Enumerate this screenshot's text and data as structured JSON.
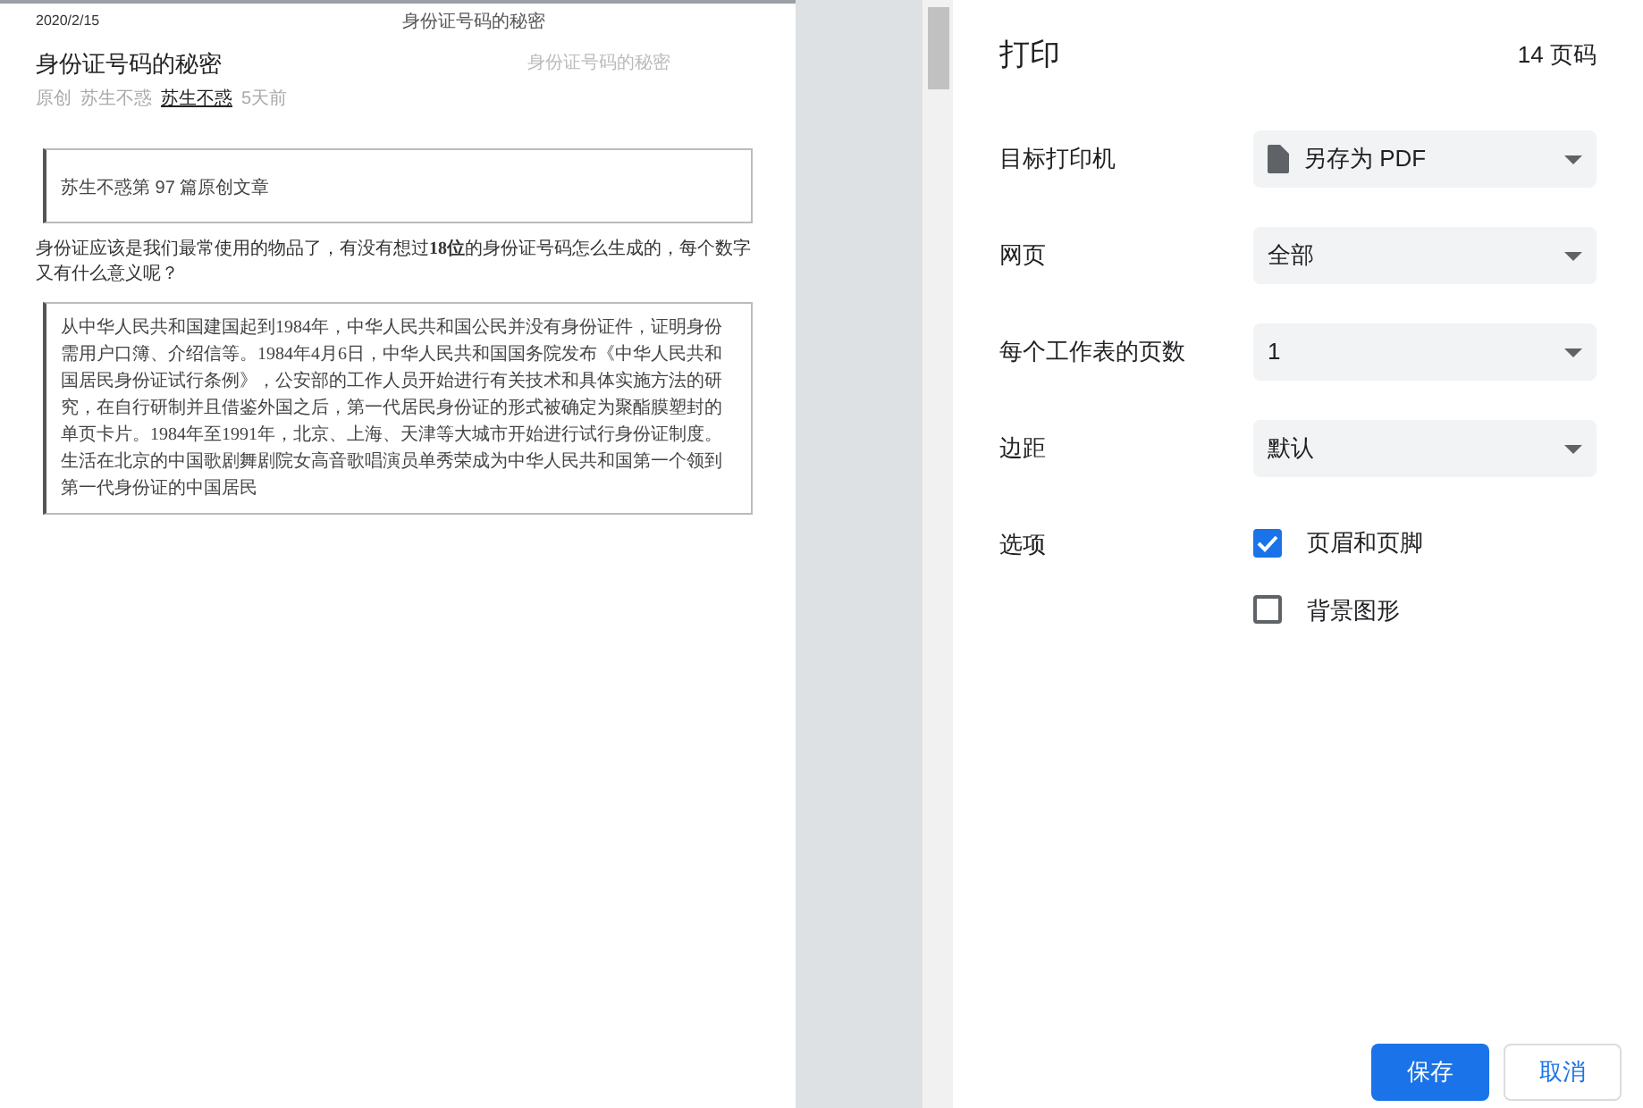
{
  "preview": {
    "header_date": "2020/2/15",
    "header_title": "身份证号码的秘密",
    "article_title": "身份证号码的秘密",
    "side_title": "身份证号码的秘密",
    "meta": [
      "原创",
      "苏生不惑",
      "苏生不惑",
      "5天前"
    ],
    "callout": "苏生不惑第 97 篇原创文章",
    "intro": "身份证应该是我们最常使用的物品了，有没有想过**18位**的身份证号码怎么生成的，每个数字又有什么意义呢？",
    "quote": "从中华人民共和国建国起到1984年，中华人民共和国公民并没有身份证件，证明身份需用户口簿、介绍信等。1984年4月6日，中华人民共和国国务院发布《中华人民共和国居民身份证试行条例》，公安部的工作人员开始进行有关技术和具体实施方法的研究，在自行研制并且借鉴外国之后，第一代居民身份证的形式被确定为聚酯膜塑封的单页卡片。1984年至1991年，北京、上海、天津等大城市开始进行试行身份证制度。生活在北京的中国歌剧舞剧院女高音歌唱演员单秀荣成为中华人民共和国第一个领到第一代身份证的中国居民"
  },
  "panel": {
    "title": "打印",
    "page_count": "14 页码",
    "settings": [
      {
        "kind": "select",
        "label": "目标打印机",
        "value": "另存为 PDF",
        "file_icon": true
      },
      {
        "kind": "select",
        "label": "网页",
        "value": "全部",
        "file_icon": false
      },
      {
        "kind": "select",
        "label": "每个工作表的页数",
        "value": "1",
        "file_icon": false
      },
      {
        "kind": "select",
        "label": "边距",
        "value": "默认",
        "file_icon": false
      },
      {
        "kind": "options",
        "label": "选项",
        "options": [
          {
            "label": "页眉和页脚",
            "checked": true
          },
          {
            "label": "背景图形",
            "checked": false
          }
        ]
      }
    ],
    "buttons": [
      {
        "label": "保存",
        "primary": true
      },
      {
        "label": "取消",
        "primary": false
      }
    ]
  }
}
